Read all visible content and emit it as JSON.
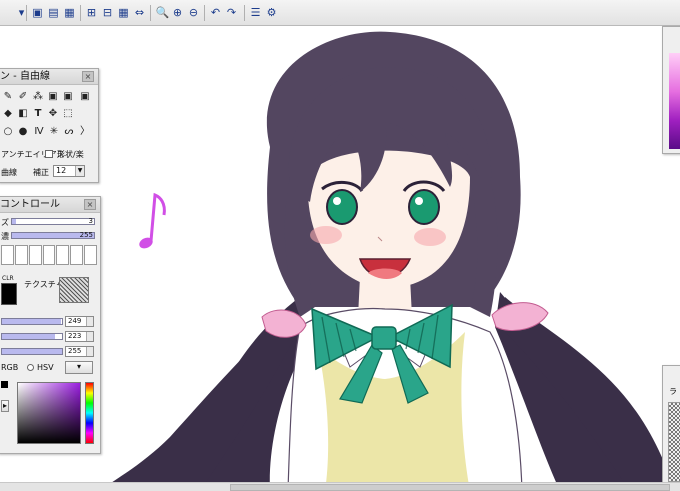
{
  "toolbar": {
    "items": [
      {
        "name": "menu-arrow-icon",
        "glyph": "▾"
      },
      {
        "name": "new-canvas-icon",
        "glyph": "▣"
      },
      {
        "name": "open-canvas-icon",
        "glyph": "▤"
      },
      {
        "name": "save-canvas-icon",
        "glyph": "▦"
      },
      {
        "name": "grid-view-icon",
        "glyph": "⊞"
      },
      {
        "name": "layout-view-icon",
        "glyph": "⊟"
      },
      {
        "name": "table-view-icon",
        "glyph": "▦"
      },
      {
        "name": "fit-width-icon",
        "glyph": "⇔"
      },
      {
        "name": "zoom-fit-icon",
        "glyph": "🔍"
      },
      {
        "name": "zoom-in-icon",
        "glyph": "⊕"
      },
      {
        "name": "zoom-out-icon",
        "glyph": "⊖"
      },
      {
        "name": "undo-icon",
        "glyph": "↶"
      },
      {
        "name": "redo-icon",
        "glyph": "↷"
      },
      {
        "name": "layer-tool-icon",
        "glyph": "☰"
      },
      {
        "name": "settings-tool-icon",
        "glyph": "⚙"
      }
    ]
  },
  "tool_panel": {
    "title": "ン - 自由線",
    "close": "×",
    "antialias_label": "アンチエイリアス",
    "shape_label": "形状/楽",
    "curve_label": "曲線",
    "correction_label": "補正",
    "correction_value": "12"
  },
  "control_panel": {
    "title": "コントロール",
    "close": "×",
    "size_label": "ズ",
    "size_value": "3",
    "size_level": 0.05,
    "density_label": "濃",
    "density_value": "255",
    "density_level": 1.0,
    "texture_label": "テクスチャ",
    "clr_label": "CLR",
    "r_value": "249",
    "g_value": "223",
    "b_value": "255",
    "r_level": 0.976,
    "g_level": 0.875,
    "b_level": 1.0,
    "rgb_label": "RGB",
    "hsv_label": "HSV",
    "picker_hue": "#9b1fe0"
  },
  "art": {
    "hair_color": "#534660",
    "hair_dark": "#3a2f48",
    "skin_color": "#fdf0e8",
    "eye_color": "#1a9a70",
    "bow_color": "#2aa58a",
    "vest_color": "#ece6a8",
    "scrunchie_color": "#f3b2d3",
    "note_color": "#d14fe6"
  }
}
